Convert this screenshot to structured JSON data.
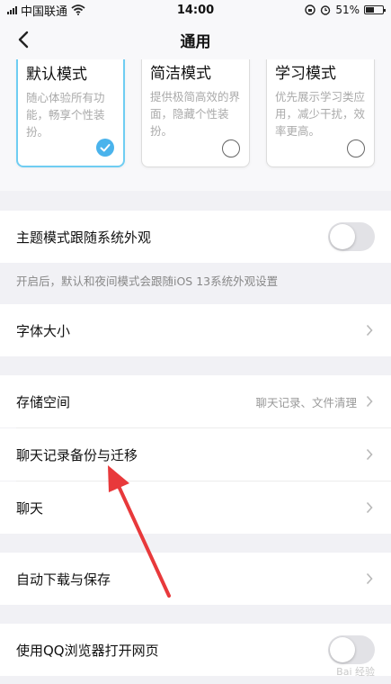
{
  "status_bar": {
    "carrier": "中国联通",
    "time": "14:00",
    "battery": "51%",
    "battery_fraction": 0.51
  },
  "navbar": {
    "title": "通用"
  },
  "modes": [
    {
      "title": "默认模式",
      "desc": "随心体验所有功能，畅享个性装扮。",
      "selected": true
    },
    {
      "title": "简洁模式",
      "desc": "提供极简高效的界面，隐藏个性装扮。",
      "selected": false
    },
    {
      "title": "学习模式",
      "desc": "优先展示学习类应用，减少干扰，效率更高。",
      "selected": false
    }
  ],
  "theme_follow": {
    "label": "主题模式跟随系统外观",
    "on": false,
    "hint": "开启后，默认和夜间模式会跟随iOS 13系统外观设置"
  },
  "font_size": {
    "label": "字体大小"
  },
  "storage": {
    "label": "存储空间",
    "detail": "聊天记录、文件清理"
  },
  "chat_backup": {
    "label": "聊天记录备份与迁移"
  },
  "chat": {
    "label": "聊天"
  },
  "auto_download": {
    "label": "自动下载与保存"
  },
  "qq_browser": {
    "label": "使用QQ浏览器打开网页",
    "on": false
  },
  "watermark": "Bai 经验",
  "colors": {
    "accent": "#4ab3ec",
    "arrow": "#e8393b",
    "background": "#f1f1f5"
  }
}
